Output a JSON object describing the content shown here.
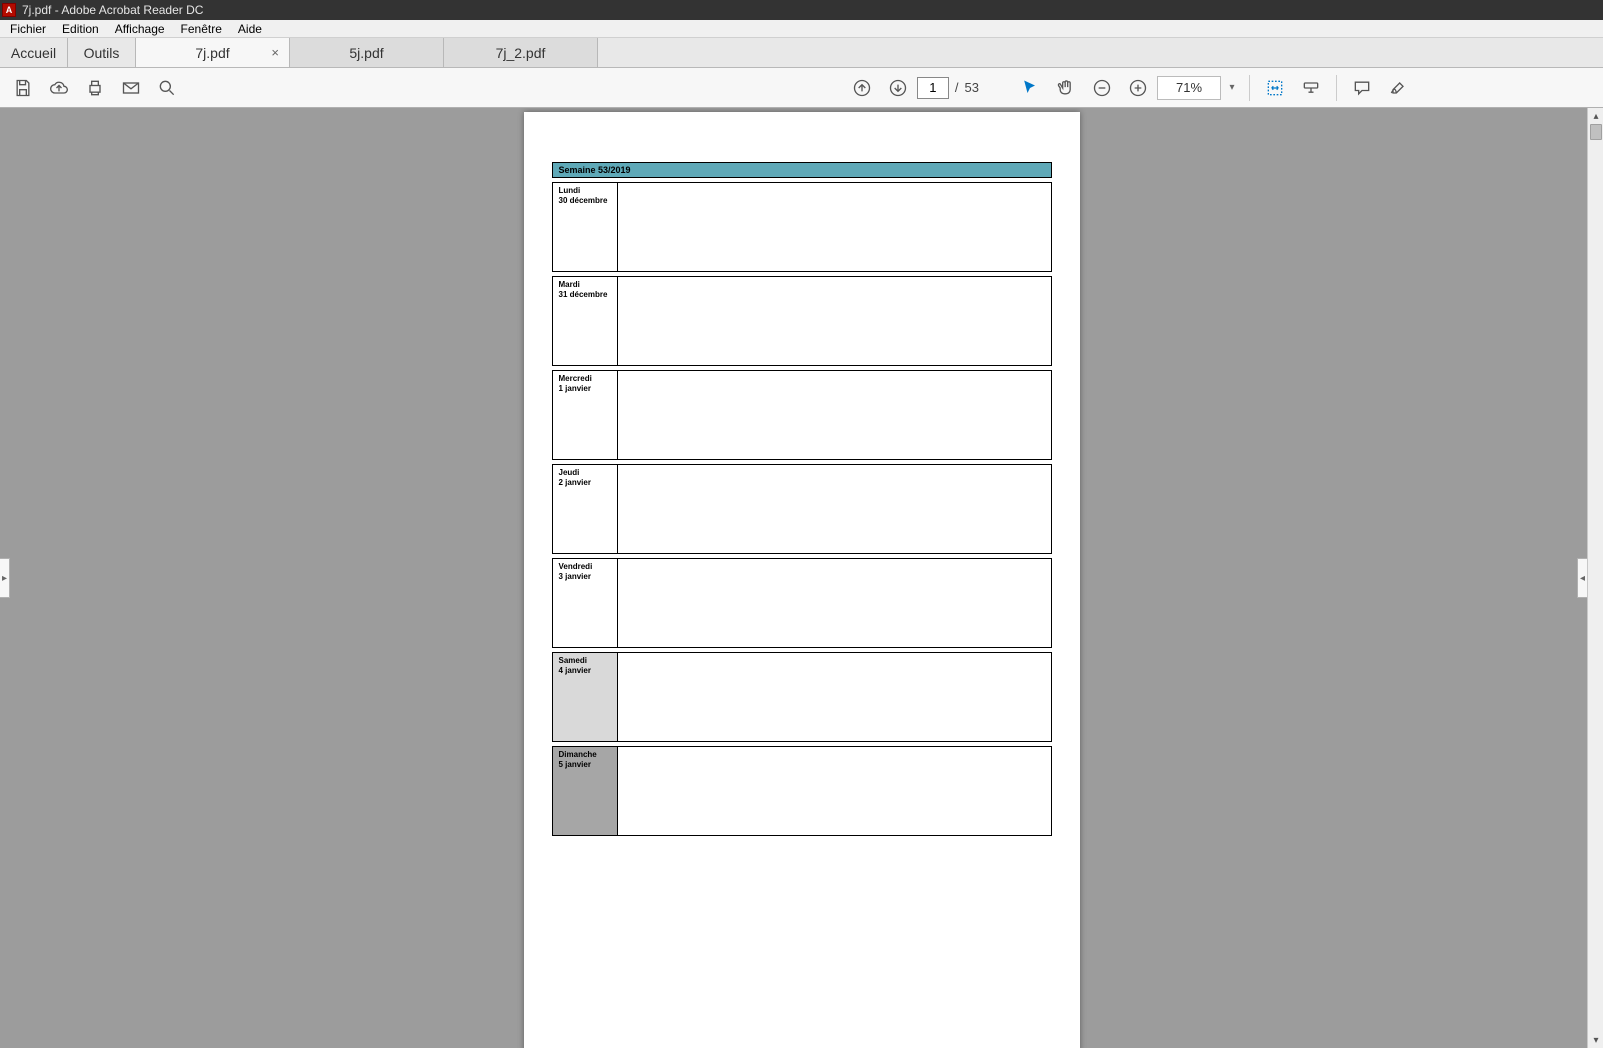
{
  "window": {
    "title": "7j.pdf - Adobe Acrobat Reader DC"
  },
  "menu": {
    "items": [
      "Fichier",
      "Edition",
      "Affichage",
      "Fenêtre",
      "Aide"
    ]
  },
  "tabs": {
    "home": "Accueil",
    "tools": "Outils",
    "files": [
      {
        "label": "7j.pdf",
        "active": true
      },
      {
        "label": "5j.pdf",
        "active": false
      },
      {
        "label": "7j_2.pdf",
        "active": false
      }
    ]
  },
  "toolbar": {
    "page_current": "1",
    "page_sep": "/",
    "page_total": "53",
    "zoom": "71%"
  },
  "document": {
    "week_header": "Semaine 53/2019",
    "days": [
      {
        "name": "Lundi",
        "date": "30 décembre",
        "class": ""
      },
      {
        "name": "Mardi",
        "date": "31 décembre",
        "class": ""
      },
      {
        "name": "Mercredi",
        "date": "1 janvier",
        "class": ""
      },
      {
        "name": "Jeudi",
        "date": "2 janvier",
        "class": ""
      },
      {
        "name": "Vendredi",
        "date": "3 janvier",
        "class": ""
      },
      {
        "name": "Samedi",
        "date": "4 janvier",
        "class": "sat"
      },
      {
        "name": "Dimanche",
        "date": "5 janvier",
        "class": "sun"
      }
    ]
  }
}
